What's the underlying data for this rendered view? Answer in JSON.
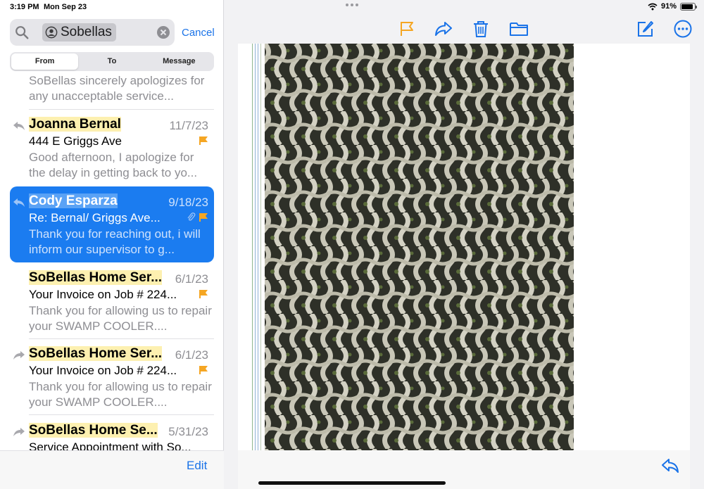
{
  "status": {
    "time": "3:19 PM",
    "date": "Mon Sep 23",
    "battery": "91%",
    "battery_level": 0.91
  },
  "search": {
    "token": "Sobellas",
    "cancel_label": "Cancel"
  },
  "segments": [
    {
      "label": "From",
      "active": true
    },
    {
      "label": "To",
      "active": false
    },
    {
      "label": "Message",
      "active": false
    }
  ],
  "messages": [
    {
      "preview": "SoBellas sincerely apologizes for any unacceptable service..."
    },
    {
      "sender": "Joanna Bernal",
      "date": "11/7/23",
      "subject": "444 E Griggs Ave",
      "preview": "Good afternoon, I apologize for the delay in getting back to yo..."
    },
    {
      "sender": "Cody Esparza",
      "date": "9/18/23",
      "subject": "Re: Bernal/ Griggs Ave...",
      "preview": "Thank you for reaching out, i will inform our supervisor to g..."
    },
    {
      "sender": "SoBellas Home Ser...",
      "date": "6/1/23",
      "subject": "Your Invoice on Job # 224...",
      "preview": "Thank you for allowing us to repair your SWAMP COOLER...."
    },
    {
      "sender": "SoBellas Home Ser...",
      "date": "6/1/23",
      "subject": "Your Invoice on Job # 224...",
      "preview": "Thank you for allowing us to repair your SWAMP COOLER...."
    },
    {
      "sender": "SoBellas Home Se...",
      "date": "5/31/23",
      "subject": "Service Appointment with So..."
    }
  ],
  "footer": {
    "edit_label": "Edit"
  },
  "colors": {
    "accent": "#1a73e8",
    "selected": "#1b7cf0",
    "flag": "#f5a623",
    "highlight": "#fdf0b0"
  }
}
